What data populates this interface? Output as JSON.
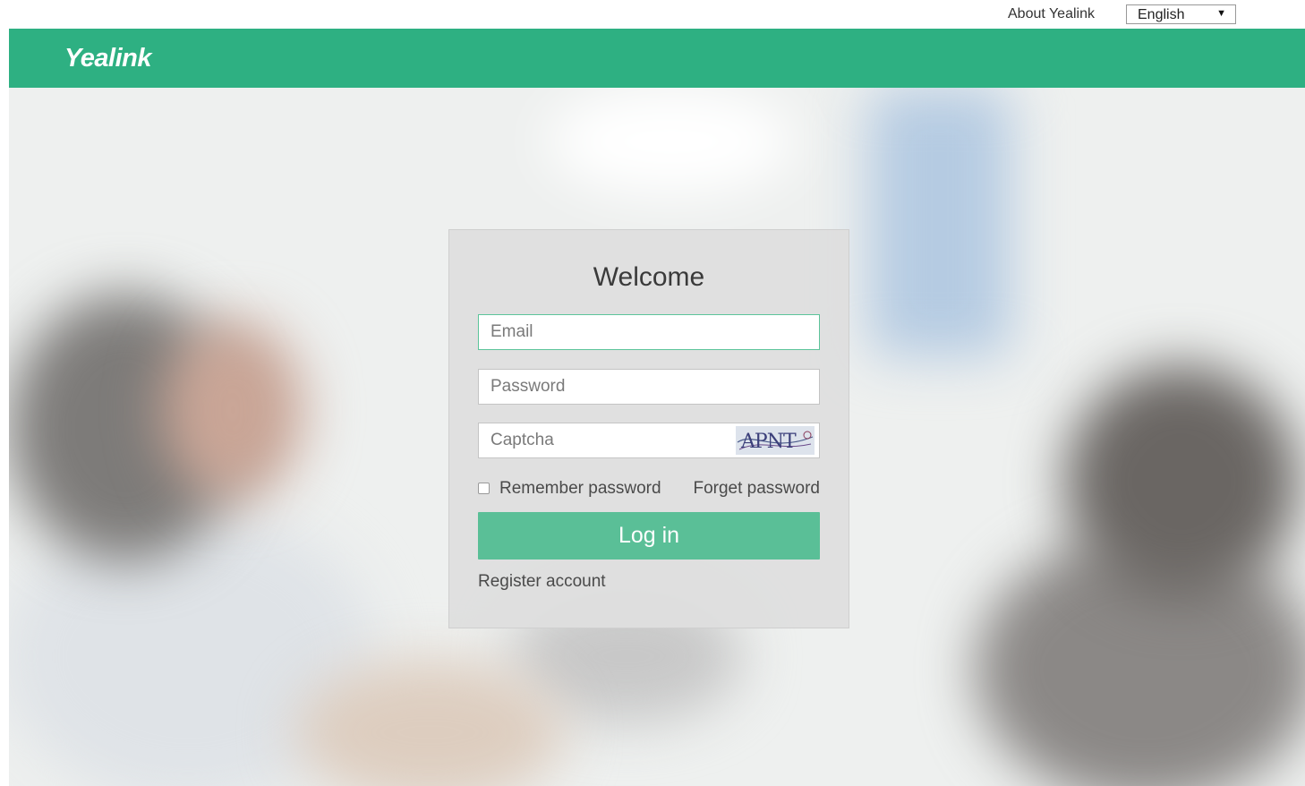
{
  "topbar": {
    "about_label": "About Yealink",
    "language": {
      "selected": "English"
    }
  },
  "header": {
    "logo_text": "Yealink",
    "brand_color": "#2eb082"
  },
  "login": {
    "title": "Welcome",
    "email": {
      "placeholder": "Email",
      "value": ""
    },
    "password": {
      "placeholder": "Password",
      "value": ""
    },
    "captcha": {
      "placeholder": "Captcha",
      "value": "",
      "image_text": "APNT"
    },
    "remember_label": "Remember password",
    "forget_label": "Forget password",
    "login_button_label": "Log in",
    "register_label": "Register account",
    "button_color": "#5abf97"
  }
}
